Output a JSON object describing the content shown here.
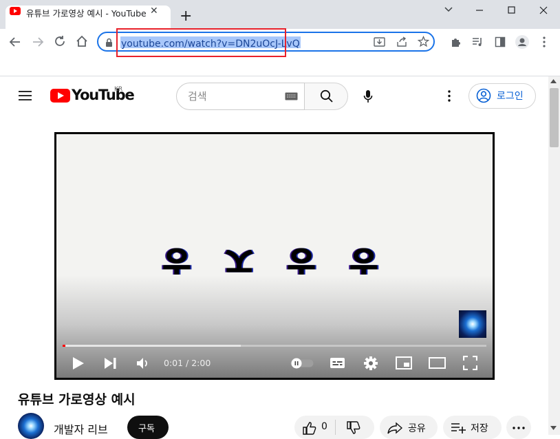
{
  "browser": {
    "tab_title": "유튜브 가로영상 예시 - YouTube",
    "new_tab": "+",
    "url": "youtube.com/watch?v=DN2uOcJ-LvQ"
  },
  "youtube": {
    "logo_text": "YouTube",
    "region": "KR",
    "search_placeholder": "검색",
    "signin_label": "로그인"
  },
  "video": {
    "caption": "ㅎ ㅈ ㅎ ㅎ",
    "time": "0:01 / 2:00",
    "progress_played": 0.005,
    "progress_loaded": 0.42,
    "title": "유튜브 가로영상 예시",
    "channel": "개발자 리브",
    "subscribe_label": "구독",
    "like_count": "0",
    "share_label": "공유",
    "save_label": "저장"
  },
  "colors": {
    "accent": "#1a73e8",
    "yt_red": "#ff0000",
    "link_blue": "#065fd4",
    "highlight": "#e8202a"
  }
}
